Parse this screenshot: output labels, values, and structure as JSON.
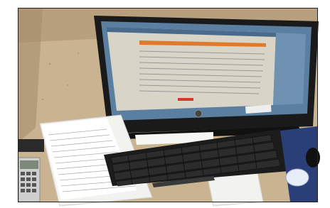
{
  "photo": {
    "colors": {
      "border": "#ffffff",
      "counter": "#c9b391",
      "counter_dark": "#a58d6a",
      "wall": "#b89f7d",
      "monitor": "#1a1a1a",
      "screen_bg": "#5a7fa0",
      "screen_window": "#d8d4c8",
      "orange_bar": "#e07a2a",
      "red_mark": "#d23a2a",
      "keyboard": "#1c1c1c",
      "key": "#2c2c2c",
      "paper": "#f2f2ef",
      "mousepad": "#2a3e78"
    },
    "icons": {
      "monitor": "monitor-icon",
      "keyboard": "keyboard-icon",
      "mouse": "mouse-icon",
      "calculator": "calculator-icon",
      "papers": "paper-stack-icon"
    }
  }
}
